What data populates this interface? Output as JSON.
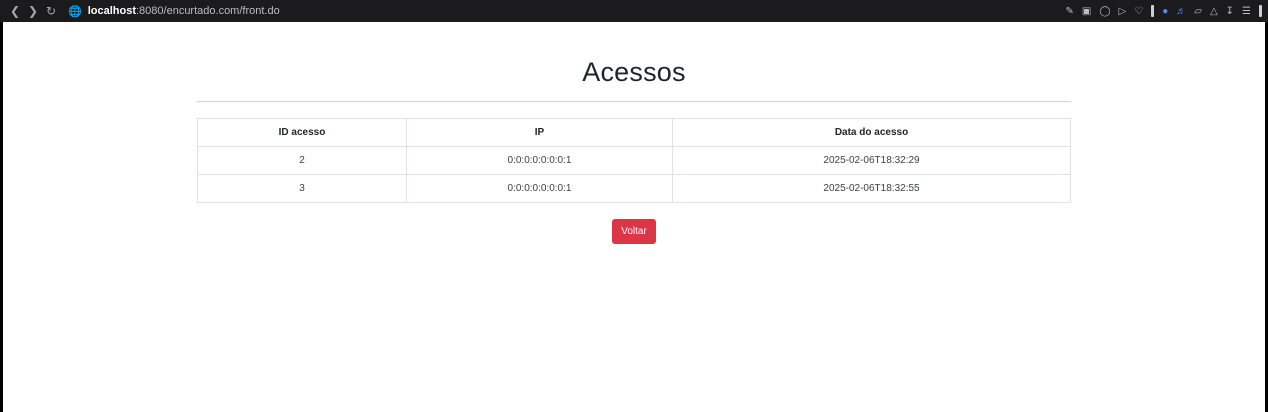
{
  "browser": {
    "url_host": "localhost",
    "url_rest": ":8080/encurtado.com/front.do"
  },
  "page": {
    "title": "Acessos",
    "table": {
      "headers": [
        "ID acesso",
        "IP",
        "Data do acesso"
      ],
      "rows": [
        [
          "2",
          "0:0:0:0:0:0:0:1",
          "2025-02-06T18:32:29"
        ],
        [
          "3",
          "0:0:0:0:0:0:0:1",
          "2025-02-06T18:32:55"
        ]
      ]
    },
    "back_button": "Voltar"
  }
}
